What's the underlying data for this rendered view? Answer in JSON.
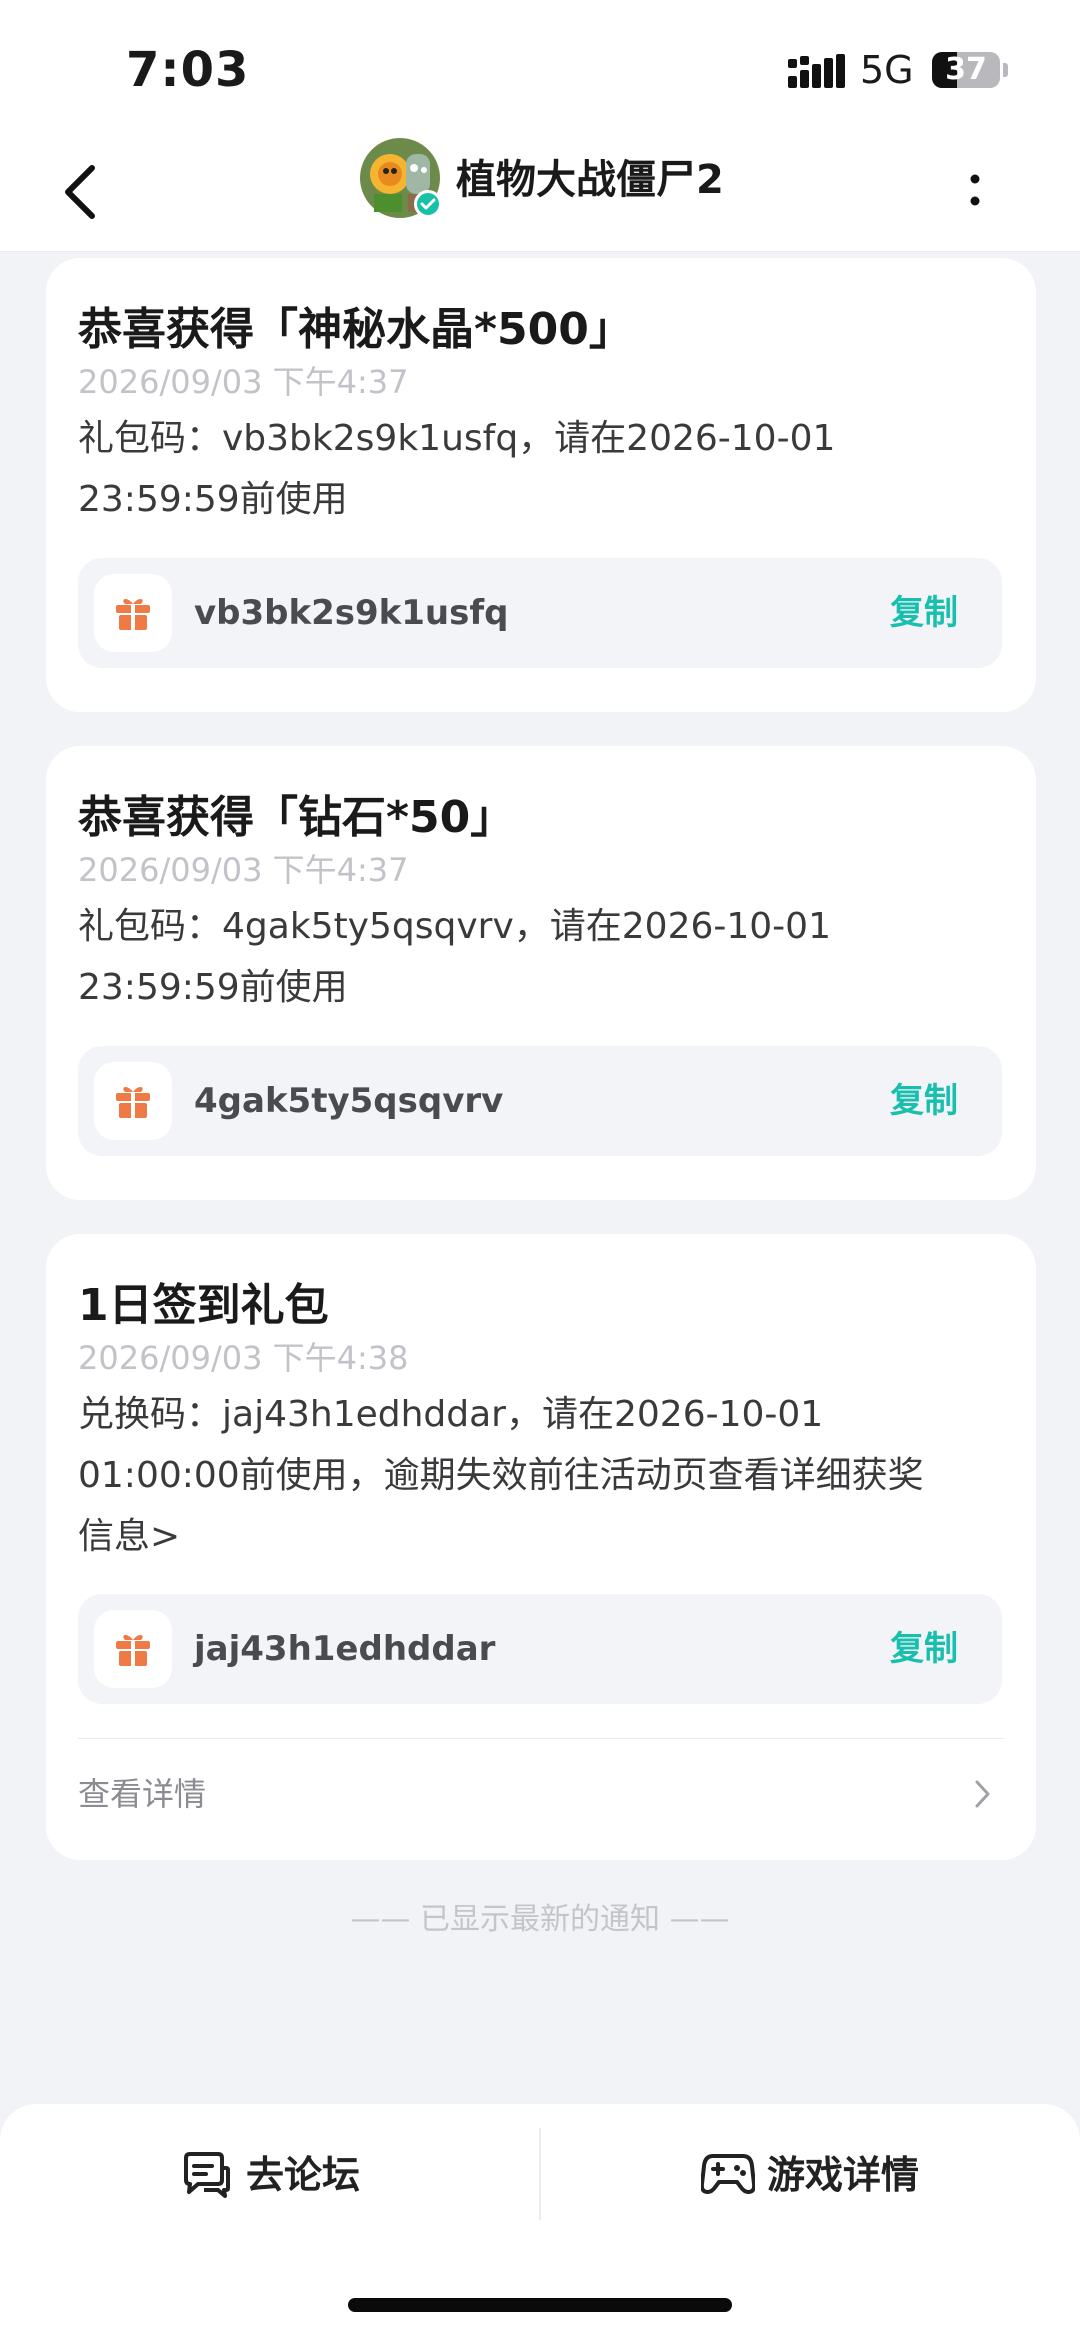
{
  "status_bar": {
    "time": "7:03",
    "network": "5G",
    "battery": 37
  },
  "header": {
    "title": "植物大战僵尸2"
  },
  "notifications": [
    {
      "title": "恭喜获得「神秘水晶*500」",
      "time": "2026/09/03 下午4:37",
      "body_line1": "礼包码：vb3bk2s9k1usfq，请在2026-10-01",
      "body_line2": "23:59:59前使用",
      "code": "vb3bk2s9k1usfq",
      "copy_label": "复制"
    },
    {
      "title": "恭喜获得「钻石*50」",
      "time": "2026/09/03 下午4:37",
      "body_line1": "礼包码：4gak5ty5qsqvrv，请在2026-10-01",
      "body_line2": "23:59:59前使用",
      "code": "4gak5ty5qsqvrv",
      "copy_label": "复制"
    },
    {
      "title": "1日签到礼包",
      "time": "2026/09/03 下午4:38",
      "body_line1": "兑换码：jaj43h1edhddar，请在2026-10-01",
      "body_line2": "01:00:00前使用，逾期失效前往活动页查看详细获奖",
      "body_line3": "信息>",
      "code": "jaj43h1edhddar",
      "copy_label": "复制",
      "detail_label": "查看详情"
    }
  ],
  "footer_note": "—— 已显示最新的通知 ——",
  "bottom_bar": {
    "forum_label": "去论坛",
    "game_detail_label": "游戏详情"
  },
  "colors": {
    "accent": "#19bfae",
    "gift_orange": "#f07a45",
    "page_bg": "#f2f3f7"
  },
  "icons": [
    "back-arrow-icon",
    "more-vertical-icon",
    "verified-icon",
    "gift-icon",
    "chevron-right-icon",
    "forum-chat-icon",
    "gamepad-icon"
  ]
}
